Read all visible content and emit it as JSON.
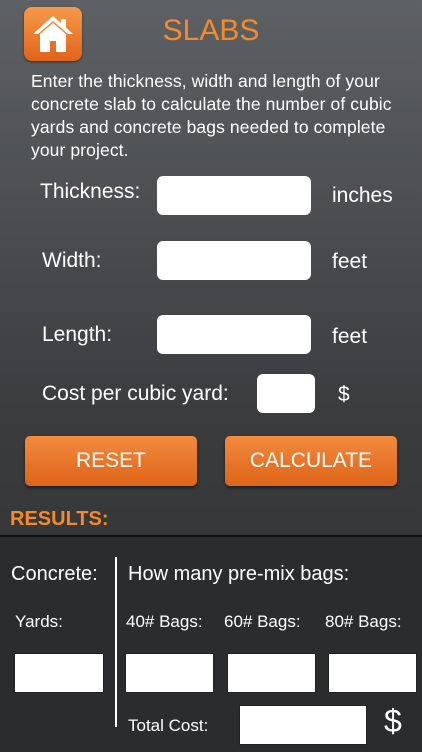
{
  "header": {
    "title": "SLABS",
    "home_icon": "home-icon"
  },
  "intro": "Enter the thickness, width and length of your concrete slab to calculate the number of cubic yards and concrete bags needed to complete your project.",
  "form": {
    "thickness": {
      "label": "Thickness:",
      "unit": "inches",
      "value": ""
    },
    "width": {
      "label": "Width:",
      "unit": "feet",
      "value": ""
    },
    "length": {
      "label": "Length:",
      "unit": "feet",
      "value": ""
    },
    "cost": {
      "label": "Cost per cubic yard:",
      "unit": "$",
      "value": ""
    }
  },
  "buttons": {
    "reset": "RESET",
    "calculate": "CALCULATE"
  },
  "results": {
    "heading": "RESULTS:",
    "concrete_label": "Concrete:",
    "bags_label": "How many pre-mix bags:",
    "yards_label": "Yards:",
    "bag40_label": "40# Bags:",
    "bag60_label": "60# Bags:",
    "bag80_label": "80# Bags:",
    "total_label": "Total Cost:",
    "total_currency": "$"
  },
  "colors": {
    "accent": "#f58a2a",
    "button": "#e2681c"
  }
}
